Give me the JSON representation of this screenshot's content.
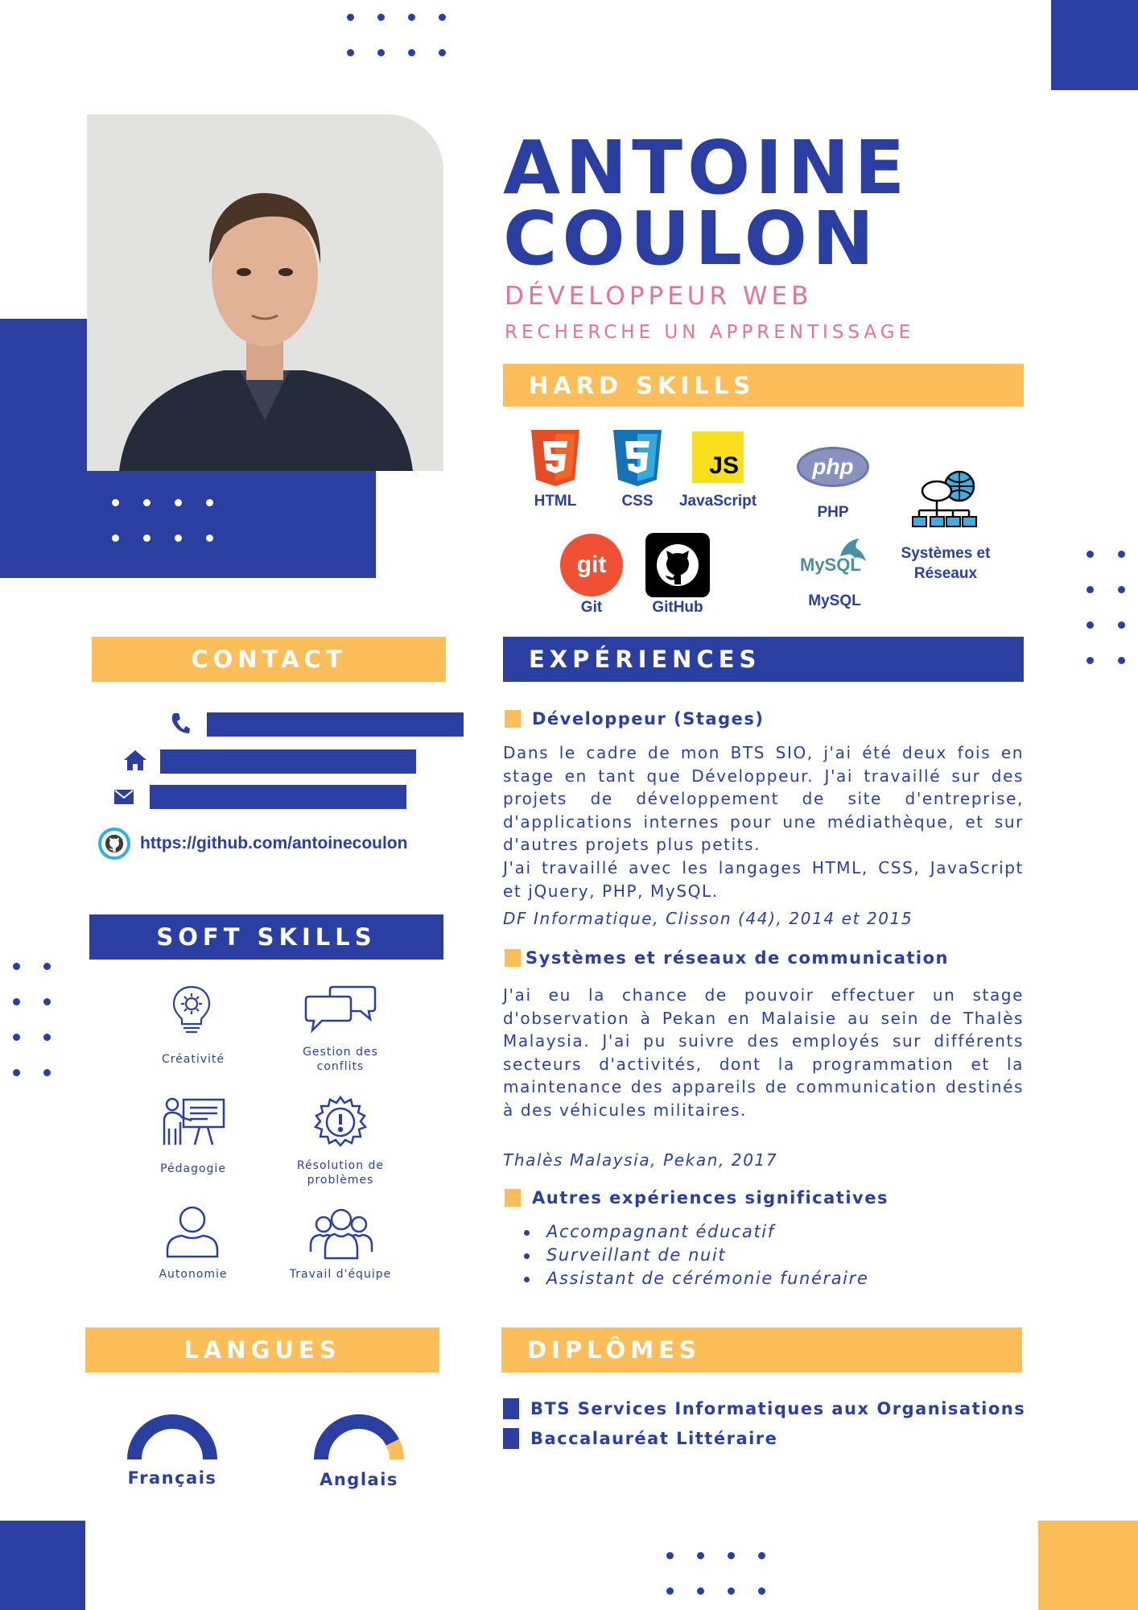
{
  "header": {
    "first_name": "ANTOINE",
    "last_name": "COULON",
    "job_title": "DÉVELOPPEUR WEB",
    "objective": "RECHERCHE UN APPRENTISSAGE"
  },
  "colors": {
    "primary": "#2b3fa3",
    "accent": "#fdbd58",
    "pink": "#e8709a"
  },
  "hard_skills": {
    "title": "HARD SKILLS",
    "items": [
      {
        "label": "HTML",
        "icon": "html5-icon"
      },
      {
        "label": "CSS",
        "icon": "css3-icon"
      },
      {
        "label": "JavaScript",
        "icon": "javascript-icon",
        "badge": "JS"
      },
      {
        "label": "PHP",
        "icon": "php-icon",
        "badge": "php"
      },
      {
        "label": "Systèmes et Réseaux",
        "icon": "network-icon"
      },
      {
        "label": "Git",
        "icon": "git-icon",
        "badge": "git"
      },
      {
        "label": "GitHub",
        "icon": "github-icon"
      },
      {
        "label": "MySQL",
        "icon": "mysql-icon",
        "badge": "MySQL"
      }
    ]
  },
  "contact": {
    "title": "CONTACT",
    "github": "https://github.com/antoinecoulon"
  },
  "soft_skills": {
    "title": "SOFT SKILLS",
    "items": [
      {
        "label": "Créativité",
        "icon": "lightbulb-gear-icon"
      },
      {
        "label": "Gestion des conflits",
        "icon": "speech-bubbles-icon"
      },
      {
        "label": "Pédagogie",
        "icon": "teacher-board-icon"
      },
      {
        "label": "Résolution de problèmes",
        "icon": "exclamation-gear-icon"
      },
      {
        "label": "Autonomie",
        "icon": "person-icon"
      },
      {
        "label": "Travail d'équipe",
        "icon": "team-icon"
      }
    ]
  },
  "experiences": {
    "title": "EXPÉRIENCES",
    "items": [
      {
        "heading": "Développeur (Stages)",
        "text": "Dans le cadre de mon BTS SIO, j'ai été deux fois en stage en tant que Développeur. J'ai travaillé sur des projets de développement de site d'entreprise, d'applications internes pour une médiathèque, et sur d'autres projets plus petits.",
        "text2": "J'ai travaillé avec les langages HTML, CSS, JavaScript et jQuery, PHP, MySQL.",
        "meta": "DF Informatique, Clisson (44), 2014 et 2015"
      },
      {
        "heading": "Systèmes et réseaux de communication",
        "text": "J'ai eu la chance de pouvoir effectuer un stage d'observation à Pekan en Malaisie au sein de Thalès Malaysia. J'ai pu suivre des employés sur différents secteurs d'activités, dont la programmation et la maintenance des appareils de communication destinés à des véhicules militaires.",
        "meta": "Thalès Malaysia, Pekan, 2017"
      },
      {
        "heading": "Autres expériences significatives",
        "list": [
          "Accompagnant éducatif",
          "Surveillant de nuit",
          "Assistant de cérémonie funéraire"
        ]
      }
    ]
  },
  "languages": {
    "title": "LANGUES",
    "items": [
      {
        "label": "Français",
        "level": 1.0
      },
      {
        "label": "Anglais",
        "level": 0.85
      }
    ]
  },
  "diplomas": {
    "title": "DIPLÔMES",
    "items": [
      "BTS Services Informatiques aux Organisations",
      "Baccalauréat Littéraire"
    ]
  }
}
